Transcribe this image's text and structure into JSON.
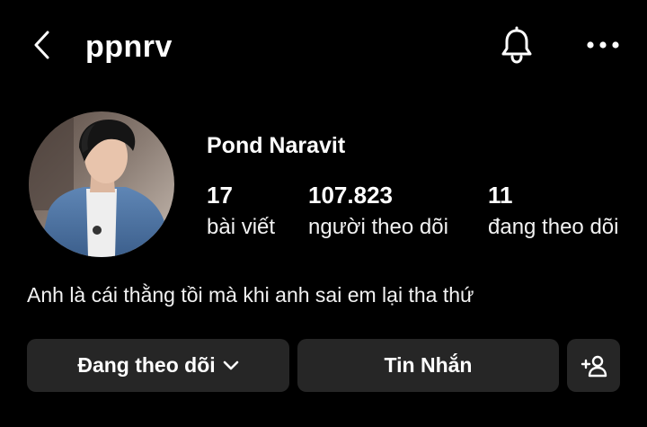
{
  "header": {
    "username": "ppnrv",
    "back_icon": "chevron-left-icon",
    "bell_icon": "bell-icon",
    "more_icon": "more-horizontal-icon"
  },
  "profile": {
    "display_name": "Pond Naravit",
    "avatar_icon": "profile-avatar",
    "stats": [
      {
        "value": "17",
        "label": "bài viết"
      },
      {
        "value": "107.823",
        "label": "người theo dõi"
      },
      {
        "value": "11",
        "label": "đang theo dõi"
      }
    ],
    "bio": "Anh là cái thằng tồi mà khi anh sai em lại tha thứ"
  },
  "actions": {
    "following_label": "Đang theo dõi",
    "message_label": "Tin Nhắn",
    "suggest_icon": "add-person-icon"
  },
  "colors": {
    "background": "#000000",
    "button_bg": "#262626",
    "text": "#ffffff"
  }
}
